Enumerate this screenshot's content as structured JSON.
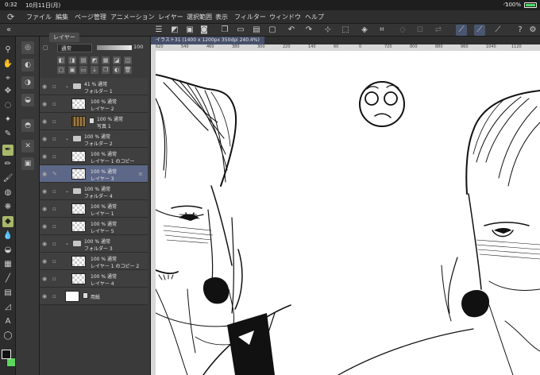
{
  "status_bar": {
    "time": "0:32",
    "date": "10月11日(月)",
    "battery": "100%"
  },
  "menu": {
    "items": [
      "ファイル",
      "編集",
      "ページ管理",
      "アニメーション",
      "レイヤー",
      "選択範囲",
      "表示",
      "フィルター",
      "ウィンドウ",
      "ヘルプ"
    ]
  },
  "layer_panel": {
    "tab_label": "レイヤー",
    "blend_mode": "通常",
    "opacity": "100",
    "layers": [
      {
        "line1": "41 % 通常",
        "line2": "フォルダー 1",
        "type": "folder",
        "indent": 0
      },
      {
        "line1": "100 % 通常",
        "line2": "レイヤー 2",
        "type": "raster",
        "indent": 1
      },
      {
        "line1": "100 % 通常",
        "line2": "写真 1",
        "type": "photo",
        "indent": 1
      },
      {
        "line1": "100 % 通常",
        "line2": "フォルダー 2",
        "type": "folder",
        "indent": 0
      },
      {
        "line1": "100 % 通常",
        "line2": "レイヤー 1 のコピー",
        "type": "raster",
        "indent": 1
      },
      {
        "line1": "100 % 通常",
        "line2": "レイヤー 3",
        "type": "raster",
        "indent": 1,
        "selected": true
      },
      {
        "line1": "100 % 通常",
        "line2": "フォルダー 4",
        "type": "folder",
        "indent": 0
      },
      {
        "line1": "100 % 通常",
        "line2": "レイヤー 1",
        "type": "raster",
        "indent": 1
      },
      {
        "line1": "100 % 通常",
        "line2": "レイヤー 5",
        "type": "raster",
        "indent": 1
      },
      {
        "line1": "100 % 通常",
        "line2": "フォルダー 3",
        "type": "folder",
        "indent": 0
      },
      {
        "line1": "100 % 通常",
        "line2": "レイヤー 1 のコピー 2",
        "type": "raster",
        "indent": 1
      },
      {
        "line1": "100 % 通常",
        "line2": "レイヤー 4",
        "type": "raster",
        "indent": 1
      },
      {
        "line1": "",
        "line2": "用紙",
        "type": "paper",
        "indent": 0
      }
    ]
  },
  "document": {
    "tab_label": "イラスト31 (1400 x 1200px 350dpi 240.4%)"
  },
  "ruler": {
    "ticks": [
      "620",
      "540",
      "460",
      "380",
      "300",
      "220",
      "140",
      "60",
      "0",
      "720",
      "800",
      "880",
      "960",
      "1040",
      "1120"
    ]
  },
  "colors": {
    "foreground": "#111111",
    "background": "#5cd65c",
    "selected_layer": "#5d6788"
  }
}
